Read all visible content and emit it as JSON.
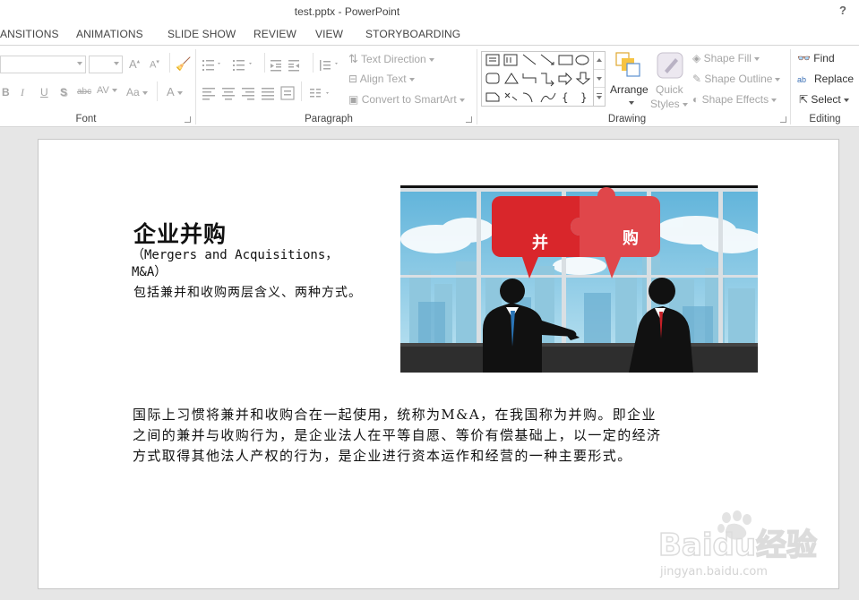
{
  "window": {
    "title": "test.pptx - PowerPoint",
    "help": "?"
  },
  "tabs": [
    "ANSITIONS",
    "ANIMATIONS",
    "SLIDE SHOW",
    "REVIEW",
    "VIEW",
    "STORYBOARDING"
  ],
  "ribbon": {
    "font": {
      "label": "Font",
      "bold": "B",
      "italic": "I",
      "underline": "U",
      "shadow": "S",
      "strike": "abc",
      "spacing": "AV",
      "case": "Aa",
      "color": "A"
    },
    "paragraph": {
      "label": "Paragraph",
      "text_direction": "Text Direction",
      "align_text": "Align Text",
      "smartart": "Convert to SmartArt"
    },
    "drawing": {
      "label": "Drawing",
      "arrange": "Arrange",
      "quick_styles_1": "Quick",
      "quick_styles_2": "Styles",
      "shape_fill": "Shape Fill",
      "shape_outline": "Shape Outline",
      "shape_effects": "Shape Effects"
    },
    "editing": {
      "label": "Editing",
      "find": "Find",
      "replace": "Replace",
      "select": "Select"
    }
  },
  "slide": {
    "title": "企业并购",
    "subtitle_en": "（Mergers and Acquisitions，M&A）",
    "subtitle_cn": "包括兼并和收购两层含义、两种方式。",
    "body": "国际上习惯将兼并和收购合在一起使用，统称为M&A，在我国称为并购。即企业之间的兼并与收购行为，是企业法人在平等自愿、等价有偿基础上，以一定的经济方式取得其他法人产权的行为，是企业进行资本运作和经营的一种主要形式。",
    "image": {
      "left_piece": "并",
      "right_piece": "购"
    }
  },
  "watermark": {
    "brand": "Baidu经验",
    "url": "jingyan.baidu.com"
  },
  "colors": {
    "accent_red": "#d9262b",
    "sky": "#7fc3df"
  }
}
